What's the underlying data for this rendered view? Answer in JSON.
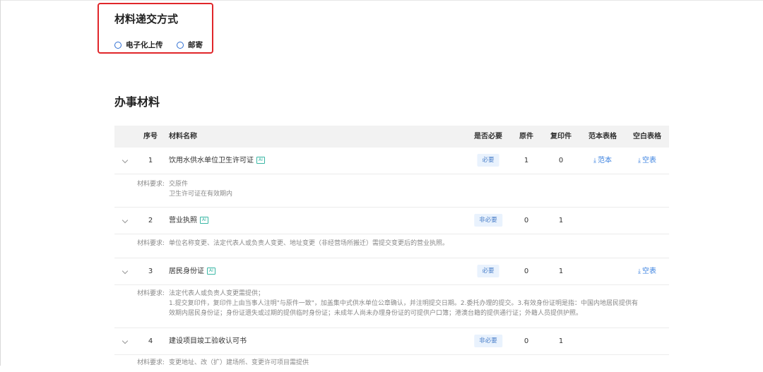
{
  "delivery": {
    "title": "材料递交方式",
    "options": [
      "电子化上传",
      "邮寄"
    ]
  },
  "section_title": "办事材料",
  "table": {
    "headers": [
      "序号",
      "材料名称",
      "是否必要",
      "原件",
      "复印件",
      "范本表格",
      "空白表格"
    ],
    "ai_tag": "AI",
    "requirement_label": "材料要求:",
    "rows": [
      {
        "no": "1",
        "name": "饮用水供水单位卫生许可证",
        "required": "必要",
        "original": "1",
        "copy": "0",
        "sample": "范本",
        "blank": "空表",
        "requirements": [
          "交原件",
          "卫生许可证在有效期内"
        ]
      },
      {
        "no": "2",
        "name": "营业执照",
        "required": "非必要",
        "original": "0",
        "copy": "1",
        "requirements": [
          "单位名称变更、法定代表人或负责人变更、地址变更（非经营场所搬迁）需提交变更后的营业执照。"
        ]
      },
      {
        "no": "3",
        "name": "居民身份证",
        "required": "必要",
        "original": "0",
        "copy": "1",
        "blank": "空表",
        "requirements": [
          "法定代表人或负责人变更需提供；",
          "1.提交复印件，复印件上由当事人注明\"与原件一致\"，加盖集中式供水单位公章确认，并注明提交日期。2.委托办理的提交。3.有效身份证明是指：中国内地居民提供有",
          "效期内居民身份证；身份证遗失或过期的提供临时身份证；未成年人尚未办理身份证的可提供户口簿；港澳台籍的提供通行证；外籍人员提供护照。"
        ]
      },
      {
        "no": "4",
        "name": "建设项目竣工验收认可书",
        "required": "非必要",
        "original": "0",
        "copy": "1",
        "requirements": [
          "变更地址、改（扩）建场所、变更许可项目需提供"
        ]
      }
    ]
  }
}
